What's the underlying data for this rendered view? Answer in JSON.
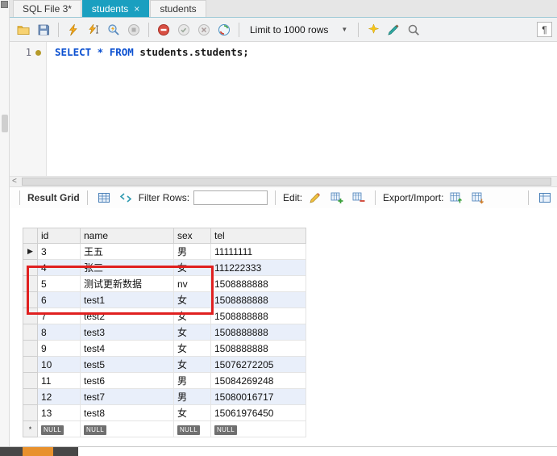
{
  "colors": {
    "active_tab": "#1a9fc0",
    "annotation_red": "#e02020",
    "stripe_blue": "#e9effa",
    "keyword_blue": "#0a4fd0",
    "null_badge": "#6f6f6f",
    "taskbar_orange": "#e8912d",
    "taskbar_dark": "#474747"
  },
  "tabs": [
    {
      "label": "SQL File 3*"
    },
    {
      "label": "students",
      "close": "×"
    },
    {
      "label": "students"
    }
  ],
  "toolbar": {
    "limit_dropdown": "Limit to 1000 rows"
  },
  "editor": {
    "line_number": "1",
    "sql_keywords": "SELECT * FROM",
    "sql_identifier": "students.students;"
  },
  "scrollbar": {
    "left_arrow": "<"
  },
  "result_toolbar": {
    "result_grid_label": "Result Grid",
    "filter_label": "Filter Rows:",
    "filter_value": "",
    "edit_label": "Edit:",
    "export_label": "Export/Import:"
  },
  "grid": {
    "columns": [
      "id",
      "name",
      "sex",
      "tel"
    ],
    "current_row_marker": "▶",
    "new_row_marker": "*",
    "null_text": "NULL",
    "rows": [
      {
        "id": "3",
        "name": "王五",
        "sex": "男",
        "tel": "11111111",
        "current": true
      },
      {
        "id": "4",
        "name": "张三",
        "sex": "女",
        "tel": "111222333"
      },
      {
        "id": "5",
        "name": "测试更新数据",
        "sex": "nv",
        "tel": "1508888888"
      },
      {
        "id": "6",
        "name": "test1",
        "sex": "女",
        "tel": "1508888888"
      },
      {
        "id": "7",
        "name": "test2",
        "sex": "女",
        "tel": "1508888888"
      },
      {
        "id": "8",
        "name": "test3",
        "sex": "女",
        "tel": "1508888888"
      },
      {
        "id": "9",
        "name": "test4",
        "sex": "女",
        "tel": "1508888888"
      },
      {
        "id": "10",
        "name": "test5",
        "sex": "女",
        "tel": "15076272205"
      },
      {
        "id": "11",
        "name": "test6",
        "sex": "男",
        "tel": "15084269248"
      },
      {
        "id": "12",
        "name": "test7",
        "sex": "男",
        "tel": "15080016717"
      },
      {
        "id": "13",
        "name": "test8",
        "sex": "女",
        "tel": "15061976450"
      }
    ]
  },
  "icons": {
    "dropdown_arrow": "▼",
    "pilcrow": "¶"
  }
}
